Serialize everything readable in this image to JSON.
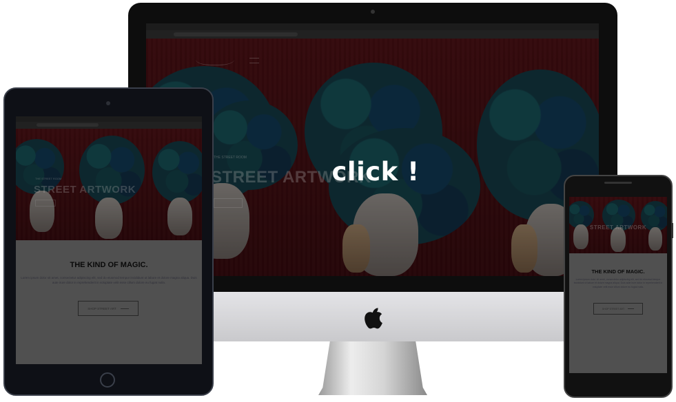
{
  "center_label": "click !",
  "desktop": {
    "hero_title": "STREET ARTWORK",
    "hero_sub": "THE STREET ROOM"
  },
  "tablet": {
    "hero_sub": "THE STREET ROOM",
    "hero_title": "STREET ARTWORK",
    "heading": "THE KIND OF MAGIC.",
    "paragraph": "Lorem ipsum dolor sit amet, consectetur adipiscing elit, sed do eiusmod tempor incididunt ut labore et dolore magna aliqua. Duis aute irure dolor in reprehenderit in voluptate velit esse cillum dolore eu fugiat nulla.",
    "button": "SHOP STREET ART"
  },
  "phone": {
    "hero_title": "STREET ARTWORK",
    "heading": "THE KIND OF MAGIC.",
    "paragraph": "Lorem ipsum dolor sit amet, consectetur adipiscing elit, sed do eiusmod tempor incididunt ut labore et dolore magna aliqua. Duis aute irure dolor in reprehenderit in voluptate velit esse cillum dolore eu fugiat nulla.",
    "button": "SHOP STREET ART"
  },
  "colors": {
    "artwork_red": "#5a1217",
    "hair_teal": "#1a4f5c",
    "device_black": "#0d0d0d",
    "imac_chin": "#c9c9cc"
  },
  "icons": [
    "apple-logo-icon",
    "camera-icon",
    "home-button-icon"
  ]
}
